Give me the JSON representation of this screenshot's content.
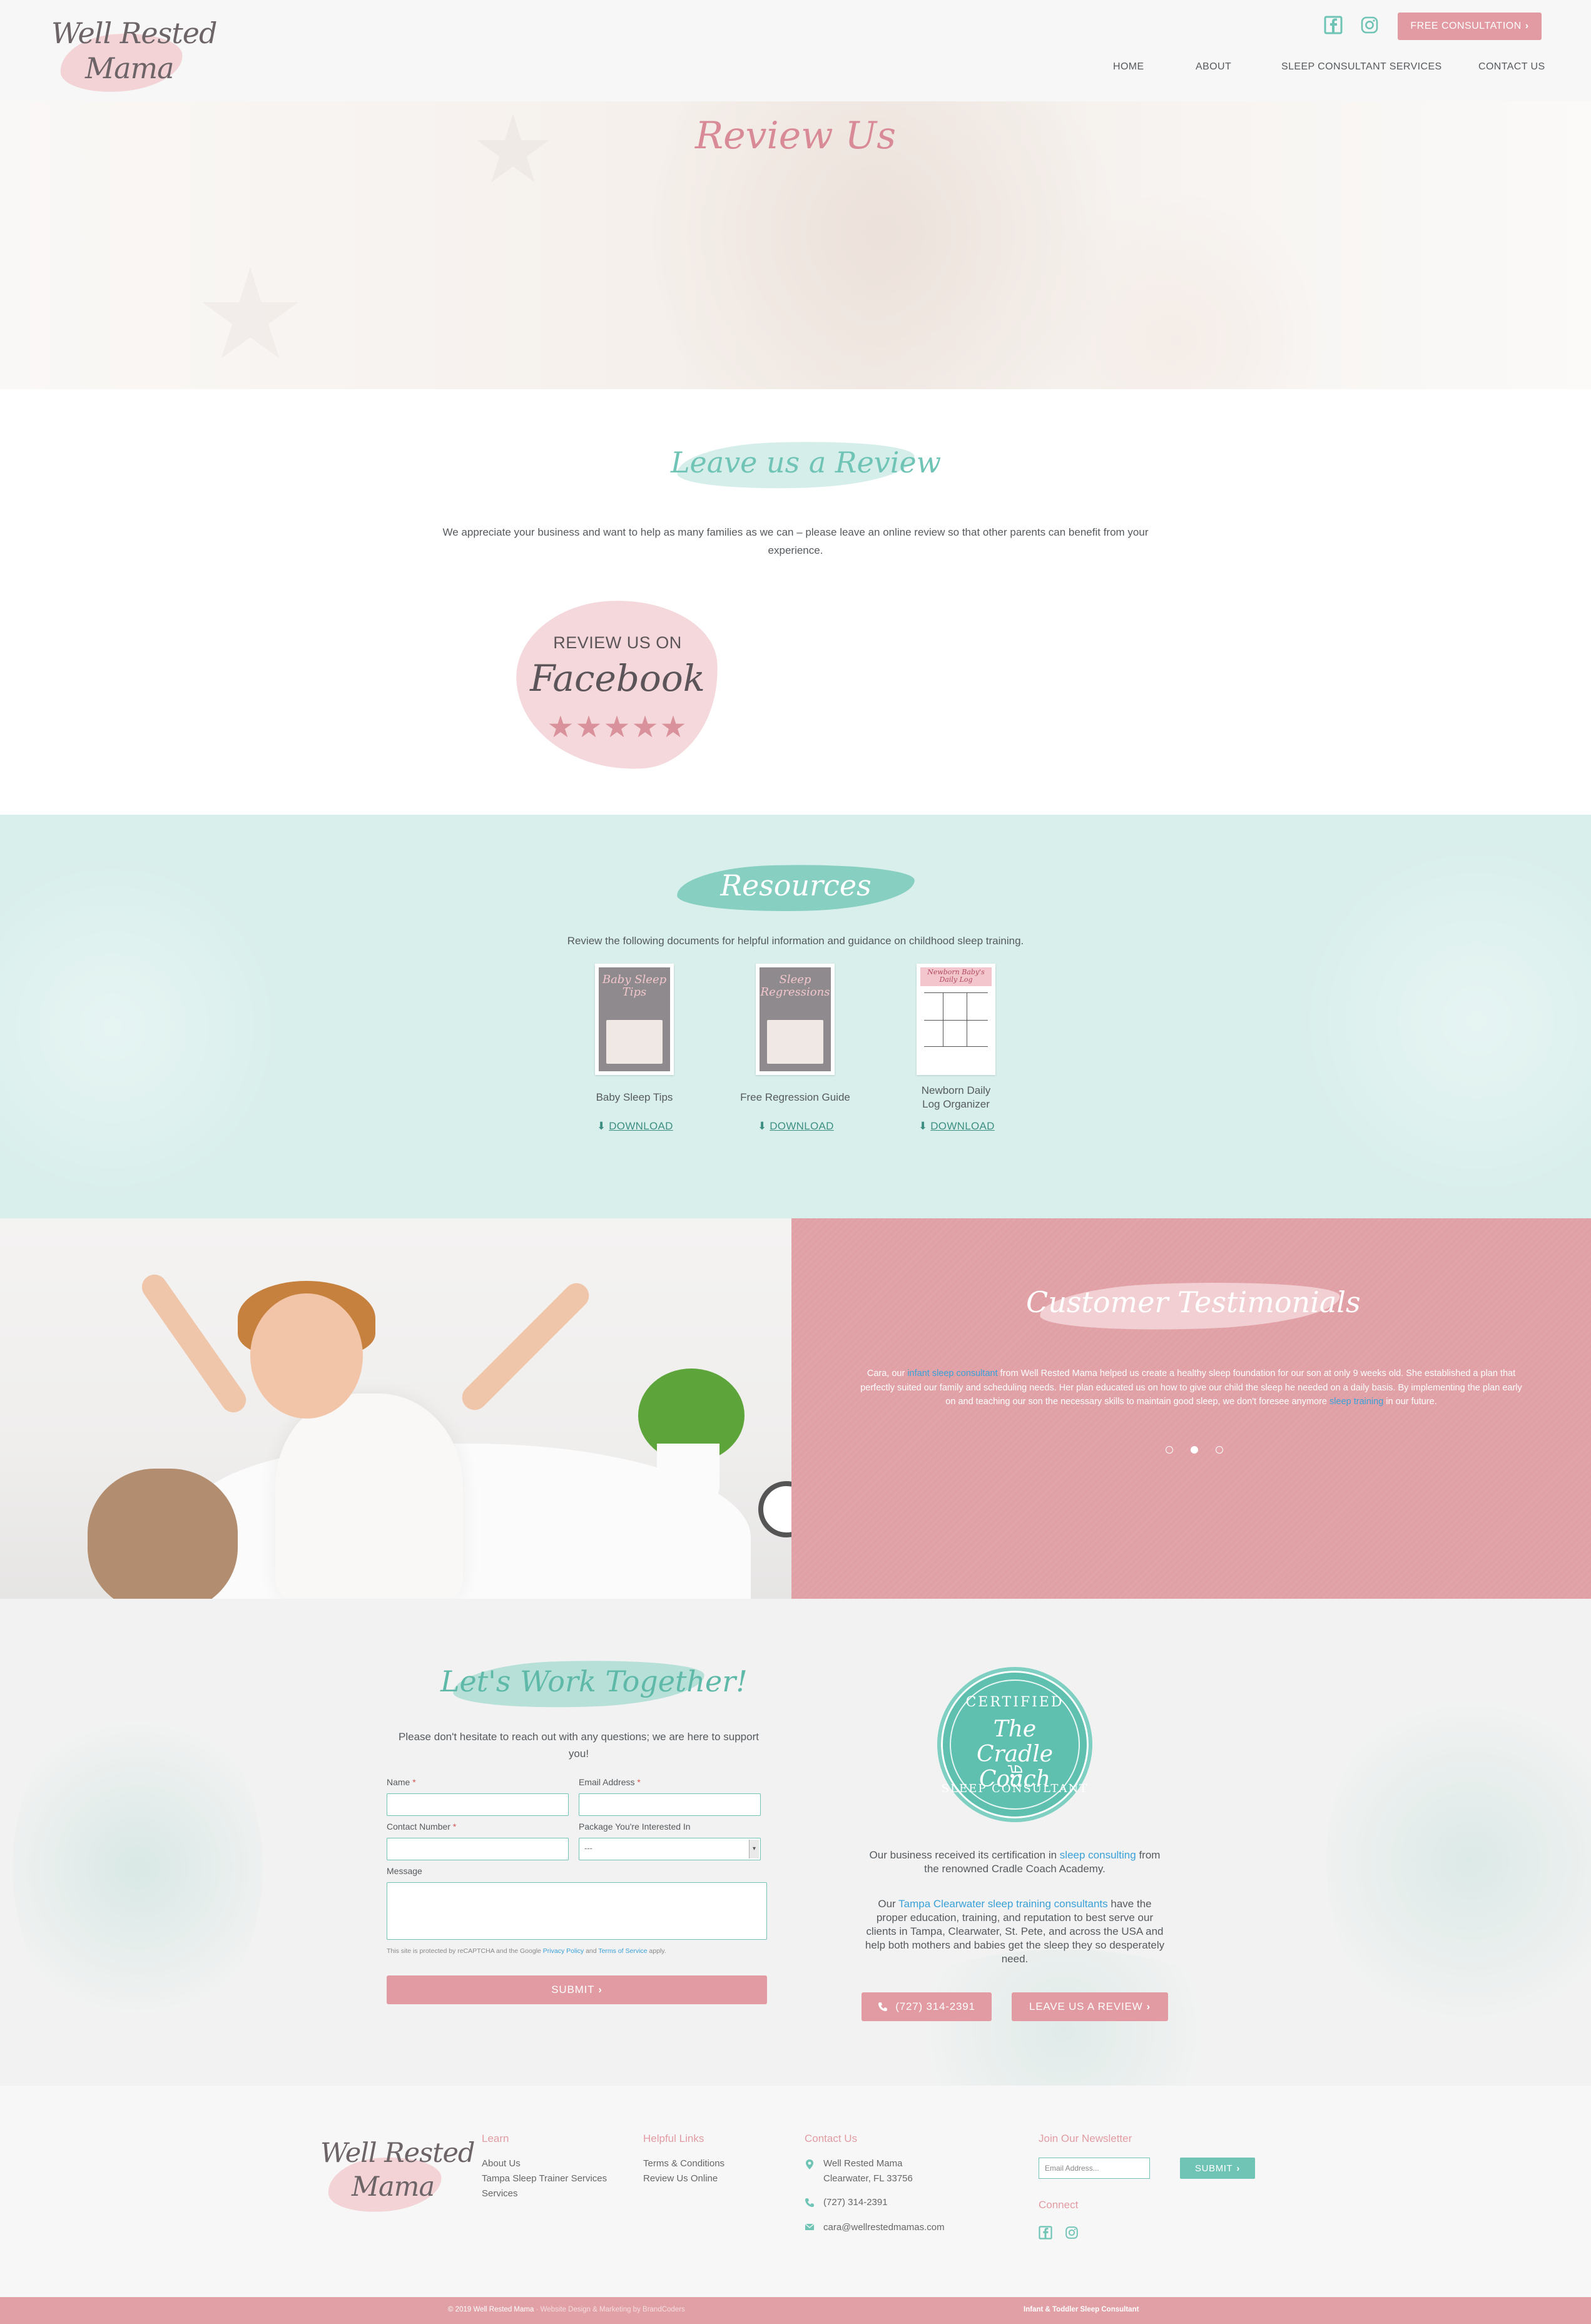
{
  "header": {
    "logo_line1": "Well Rested",
    "logo_line2": "Mama",
    "cta_label": "FREE CONSULTATION",
    "nav": {
      "home": "HOME",
      "about": "ABOUT",
      "services": "SLEEP CONSULTANT SERVICES",
      "contact": "CONTACT US"
    },
    "icons": [
      "facebook-icon",
      "instagram-icon"
    ]
  },
  "hero": {
    "title": "Review Us"
  },
  "review_section": {
    "title": "Leave us a Review",
    "text": "We appreciate your business and want to help as many families as we can – please leave an online review so that other parents can benefit from your experience.",
    "facebook_badge": {
      "line1": "REVIEW US ON",
      "line2": "Facebook",
      "stars": "★★★★★"
    }
  },
  "resources": {
    "title": "Resources",
    "text": "Review the following documents for helpful information and guidance on childhood sleep training.",
    "download_label": "DOWNLOAD",
    "items": [
      {
        "label": "Baby Sleep Tips",
        "thumb_title": "Baby Sleep Tips"
      },
      {
        "label": "Free Regression Guide",
        "thumb_title": "Sleep Regressions"
      },
      {
        "label_line1": "Newborn Daily",
        "label_line2": "Log Organizer",
        "thumb_title": "Newborn Baby's Daily Log"
      }
    ]
  },
  "testimonials": {
    "title": "Customer Testimonials",
    "quote": {
      "p1": "Cara, our ",
      "link1": "infant sleep consultant",
      "p2": " from Well Rested Mama helped us create a healthy sleep foundation for our son at only 9 weeks old. She established a plan that perfectly suited our family and scheduling needs. Her plan educated us on how to give our child the sleep he needed on a daily basis. By implementing the plan early on and teaching our son the necessary skills to maintain good sleep, we don't foresee anymore ",
      "link2": "sleep training",
      "p3": " in our future."
    },
    "slides": 3,
    "active_slide": 2
  },
  "contact": {
    "title": "Let's Work Together!",
    "text": "Please don't hesitate to reach out with any questions; we are here to support you!",
    "form": {
      "name_label": "Name",
      "email_label": "Email Address",
      "phone_label": "Contact Number",
      "package_label": "Package You're Interested In",
      "package_value": "---",
      "message_label": "Message",
      "required_mark": "*",
      "recaptcha_p1": "This site is protected by reCAPTCHA and the Google ",
      "recaptcha_privacy": "Privacy Policy",
      "recaptcha_and": " and ",
      "recaptcha_terms": "Terms of Service",
      "recaptcha_p2": " apply.",
      "submit_label": "SUBMIT"
    },
    "badge": {
      "top": "CERTIFIED",
      "middle1": "The",
      "middle2": "Cradle Coach",
      "bottom": "SLEEP CONSULTANT"
    },
    "cert": {
      "p1": "Our business received its certification in ",
      "link": "sleep consulting",
      "p2": " from the renowned Cradle Coach Academy."
    },
    "team": {
      "p1": "Our ",
      "link": "Tampa Clearwater sleep training consultants",
      "p2": " have the proper education, training, and reputation to best serve our clients in Tampa, Clearwater, St. Pete, and across the USA and help both mothers and babies get the sleep they so desperately need."
    },
    "phone_button": "(727) 314-2391",
    "review_button": "LEAVE US A REVIEW"
  },
  "footer": {
    "logo_line1": "Well Rested",
    "logo_line2": "Mama",
    "learn": {
      "heading": "Learn",
      "links": [
        "About Us",
        "Tampa Sleep Trainer Services",
        "Services"
      ]
    },
    "helpful": {
      "heading": "Helpful Links",
      "links": [
        "Terms & Conditions",
        "Review Us Online"
      ]
    },
    "contact": {
      "heading": "Contact Us",
      "name": "Well Rested Mama",
      "address": "Clearwater, FL 33756",
      "phone": "(727) 314-2391",
      "email": "cara@wellrestedmamas.com"
    },
    "newsletter": {
      "heading": "Join Our Newsletter",
      "placeholder": "Email Address...",
      "submit": "SUBMIT"
    },
    "connect": {
      "heading": "Connect"
    }
  },
  "bottom_bar": {
    "copyright": "© 2019 Well Rested Mama",
    "credit": " · Website Design & Marketing by BrandCoders",
    "tagline": "Infant & Toddler Sleep Consultant"
  },
  "colors": {
    "pink": "#e29ba2",
    "teal": "#6fc4b5",
    "mint_bg": "#d9efec",
    "testimonial_bg": "#e0a0a6",
    "link_blue": "#3aa0d8"
  }
}
